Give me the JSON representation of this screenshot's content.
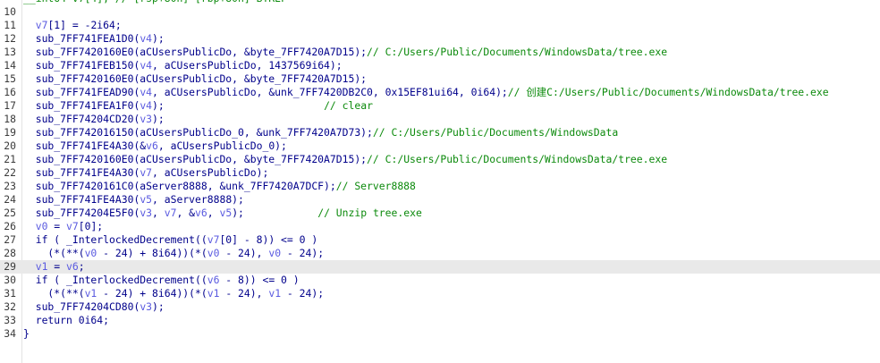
{
  "first_line_partial": {
    "number": "",
    "segments": [
      {
        "t": "__int64 v7[4]; // [rsp+80h] [rbp+80h] BYREF",
        "c": "com"
      }
    ]
  },
  "lines": [
    {
      "number": "10",
      "segments": []
    },
    {
      "number": "11",
      "segments": [
        {
          "t": "  ",
          "c": "txt"
        },
        {
          "t": "v7",
          "c": "var"
        },
        {
          "t": "[1] = -2i64;",
          "c": "txt"
        }
      ]
    },
    {
      "number": "12",
      "segments": [
        {
          "t": "  sub_7FF741FEA1D0(",
          "c": "txt"
        },
        {
          "t": "v4",
          "c": "var"
        },
        {
          "t": ");",
          "c": "txt"
        }
      ]
    },
    {
      "number": "13",
      "segments": [
        {
          "t": "  sub_7FF7420160E0(aCUsersPublicDo, &byte_7FF7420A7D15);",
          "c": "txt"
        },
        {
          "t": "// C:/Users/Public/Documents/WindowsData/tree.exe",
          "c": "com"
        }
      ]
    },
    {
      "number": "14",
      "segments": [
        {
          "t": "  sub_7FF741FEB150(",
          "c": "txt"
        },
        {
          "t": "v4",
          "c": "var"
        },
        {
          "t": ", aCUsersPublicDo, 1437569i64);",
          "c": "txt"
        }
      ]
    },
    {
      "number": "15",
      "segments": [
        {
          "t": "  sub_7FF7420160E0(aCUsersPublicDo, &byte_7FF7420A7D15);",
          "c": "txt"
        }
      ]
    },
    {
      "number": "16",
      "segments": [
        {
          "t": "  sub_7FF741FEAD90(",
          "c": "txt"
        },
        {
          "t": "v4",
          "c": "var"
        },
        {
          "t": ", aCUsersPublicDo, &unk_7FF7420DB2C0, 0x15EF81ui64, 0i64);",
          "c": "txt"
        },
        {
          "t": "// 创建C:/Users/Public/Documents/WindowsData/tree.exe",
          "c": "com"
        }
      ]
    },
    {
      "number": "17",
      "segments": [
        {
          "t": "  sub_7FF741FEA1F0(",
          "c": "txt"
        },
        {
          "t": "v4",
          "c": "var"
        },
        {
          "t": ");",
          "c": "txt"
        },
        {
          "t": "                          ",
          "c": "txt"
        },
        {
          "t": "// clear",
          "c": "com"
        }
      ]
    },
    {
      "number": "18",
      "segments": [
        {
          "t": "  sub_7FF74204CD20(",
          "c": "txt"
        },
        {
          "t": "v3",
          "c": "var"
        },
        {
          "t": ");",
          "c": "txt"
        }
      ]
    },
    {
      "number": "19",
      "segments": [
        {
          "t": "  sub_7FF742016150(aCUsersPublicDo_0, &unk_7FF7420A7D73);",
          "c": "txt"
        },
        {
          "t": "// C:/Users/Public/Documents/WindowsData",
          "c": "com"
        }
      ]
    },
    {
      "number": "20",
      "segments": [
        {
          "t": "  sub_7FF741FE4A30(&",
          "c": "txt"
        },
        {
          "t": "v6",
          "c": "var"
        },
        {
          "t": ", aCUsersPublicDo_0);",
          "c": "txt"
        }
      ]
    },
    {
      "number": "21",
      "segments": [
        {
          "t": "  sub_7FF7420160E0(aCUsersPublicDo, &byte_7FF7420A7D15);",
          "c": "txt"
        },
        {
          "t": "// C:/Users/Public/Documents/WindowsData/tree.exe",
          "c": "com"
        }
      ]
    },
    {
      "number": "22",
      "segments": [
        {
          "t": "  sub_7FF741FE4A30(",
          "c": "txt"
        },
        {
          "t": "v7",
          "c": "var"
        },
        {
          "t": ", aCUsersPublicDo);",
          "c": "txt"
        }
      ]
    },
    {
      "number": "23",
      "segments": [
        {
          "t": "  sub_7FF7420161C0(aServer8888, &unk_7FF7420A7DCF);",
          "c": "txt"
        },
        {
          "t": "// Server8888",
          "c": "com"
        }
      ]
    },
    {
      "number": "24",
      "segments": [
        {
          "t": "  sub_7FF741FE4A30(",
          "c": "txt"
        },
        {
          "t": "v5",
          "c": "var"
        },
        {
          "t": ", aServer8888);",
          "c": "txt"
        }
      ]
    },
    {
      "number": "25",
      "segments": [
        {
          "t": "  sub_7FF74204E5F0(",
          "c": "txt"
        },
        {
          "t": "v3",
          "c": "var"
        },
        {
          "t": ", ",
          "c": "txt"
        },
        {
          "t": "v7",
          "c": "var"
        },
        {
          "t": ", &",
          "c": "txt"
        },
        {
          "t": "v6",
          "c": "var"
        },
        {
          "t": ", ",
          "c": "txt"
        },
        {
          "t": "v5",
          "c": "var"
        },
        {
          "t": ");",
          "c": "txt"
        },
        {
          "t": "            ",
          "c": "txt"
        },
        {
          "t": "// Unzip tree.exe",
          "c": "com"
        }
      ]
    },
    {
      "number": "26",
      "segments": [
        {
          "t": "  ",
          "c": "txt"
        },
        {
          "t": "v0",
          "c": "var"
        },
        {
          "t": " = ",
          "c": "txt"
        },
        {
          "t": "v7",
          "c": "var"
        },
        {
          "t": "[0];",
          "c": "txt"
        }
      ]
    },
    {
      "number": "27",
      "segments": [
        {
          "t": "  if ( _InterlockedDecrement((",
          "c": "txt"
        },
        {
          "t": "v7",
          "c": "var"
        },
        {
          "t": "[0] - 8)) <= 0 )",
          "c": "txt"
        }
      ]
    },
    {
      "number": "28",
      "segments": [
        {
          "t": "    (*(**(",
          "c": "txt"
        },
        {
          "t": "v0",
          "c": "var"
        },
        {
          "t": " - 24) + 8i64))(*(",
          "c": "txt"
        },
        {
          "t": "v0",
          "c": "var"
        },
        {
          "t": " - 24), ",
          "c": "txt"
        },
        {
          "t": "v0",
          "c": "var"
        },
        {
          "t": " - 24);",
          "c": "txt"
        }
      ]
    },
    {
      "number": "29",
      "highlight": true,
      "segments": [
        {
          "t": "  ",
          "c": "txt"
        },
        {
          "t": "v1",
          "c": "var"
        },
        {
          "t": " = ",
          "c": "txt"
        },
        {
          "t": "v6",
          "c": "var"
        },
        {
          "t": ";",
          "c": "txt"
        }
      ]
    },
    {
      "number": "30",
      "segments": [
        {
          "t": "  if ( _InterlockedDecrement((",
          "c": "txt"
        },
        {
          "t": "v6",
          "c": "var"
        },
        {
          "t": " - 8)) <= 0 )",
          "c": "txt"
        }
      ]
    },
    {
      "number": "31",
      "segments": [
        {
          "t": "    (*(**(",
          "c": "txt"
        },
        {
          "t": "v1",
          "c": "var"
        },
        {
          "t": " - 24) + 8i64))(*(",
          "c": "txt"
        },
        {
          "t": "v1",
          "c": "var"
        },
        {
          "t": " - 24), ",
          "c": "txt"
        },
        {
          "t": "v1",
          "c": "var"
        },
        {
          "t": " - 24);",
          "c": "txt"
        }
      ]
    },
    {
      "number": "32",
      "segments": [
        {
          "t": "  sub_7FF74204CD80(",
          "c": "txt"
        },
        {
          "t": "v3",
          "c": "var"
        },
        {
          "t": ");",
          "c": "txt"
        }
      ]
    },
    {
      "number": "33",
      "segments": [
        {
          "t": "  return 0i64;",
          "c": "txt"
        }
      ]
    },
    {
      "number": "34",
      "segments": [
        {
          "t": "}",
          "c": "txt"
        }
      ]
    }
  ]
}
